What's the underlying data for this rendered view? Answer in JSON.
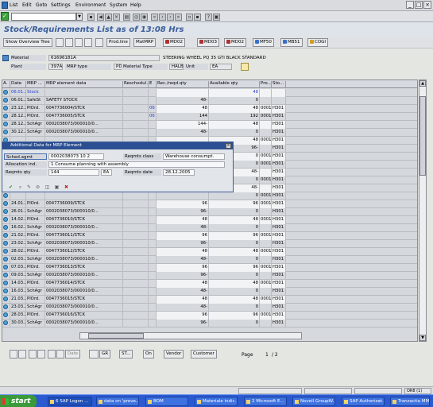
{
  "menu": [
    "List",
    "Edit",
    "Goto",
    "Settings",
    "Environment",
    "System",
    "Help"
  ],
  "title": "Stock/Requirements List as of 13:08 Hrs",
  "toolbar": {
    "show_overview_tree": "Show Overview Tree",
    "prod_line": "Prod.line",
    "mat_mrp": "MatMRP",
    "md02a": "MD02",
    "md03": "MD03",
    "md02b": "MD02",
    "mf50": "MF50",
    "mb51": "MB51",
    "cogi": "COGI"
  },
  "header": {
    "material_label": "Material",
    "material_value": "61696181A",
    "material_desc": "STEERING WHEEL PQ 35 GTI BLACK STANDARD",
    "plant_label": "Plant",
    "plant_value": "397A",
    "mrp_type_label": "MRP type",
    "mrp_type_value": "PD",
    "material_type_label": "Material Type",
    "material_type_value": "HALB",
    "unit_label": "Unit",
    "unit_value": "EA"
  },
  "grid": {
    "columns": [
      "A.",
      "Date",
      "MRP ...",
      "MRP element data",
      "Reschedul...",
      "E",
      "Rec./reqd.qty",
      "Available qty",
      "Pro...",
      "Sto..."
    ],
    "rows": [
      {
        "date": "06.01.2006",
        "mrp": "Stock",
        "data": "",
        "resch": "",
        "e": "",
        "rec": "",
        "avail": "48",
        "pro": "",
        "sto": "",
        "blue": true
      },
      {
        "date": "06.01.2006",
        "mrp": "SafeSt",
        "data": "SAFETY STOCK",
        "resch": "",
        "e": "",
        "rec": "48-",
        "avail": "0",
        "pro": "",
        "sto": ""
      },
      {
        "date": "23.12.2005",
        "mrp": "PlOrd.",
        "data": "0047736004/STCK",
        "resch": "",
        "e": "06",
        "rec": "48",
        "avail": "48",
        "pro": "0001",
        "sto": "H301"
      },
      {
        "date": "28.12.2005",
        "mrp": "PlOrd.",
        "data": "0047736005/STCK",
        "resch": "",
        "e": "06",
        "rec": "144",
        "avail": "192",
        "pro": "0001",
        "sto": "H301"
      },
      {
        "date": "28.12.2005",
        "mrp": "SchAgr",
        "data": "0002038073/000010/0...",
        "resch": "",
        "e": "",
        "rec": "144-",
        "avail": "48",
        "pro": "",
        "sto": "H301"
      },
      {
        "date": "30.12.2005",
        "mrp": "SchAgr",
        "data": "0002038073/000010/0...",
        "resch": "",
        "e": "",
        "rec": "48-",
        "avail": "0",
        "pro": "",
        "sto": "H301"
      },
      {
        "date": "",
        "mrp": "",
        "data": "",
        "resch": "",
        "e": "",
        "rec": "",
        "avail": "48",
        "pro": "0001",
        "sto": "H301"
      },
      {
        "date": "",
        "mrp": "",
        "data": "",
        "resch": "",
        "e": "",
        "rec": "",
        "avail": "96-",
        "pro": "",
        "sto": "H301"
      },
      {
        "date": "",
        "mrp": "",
        "data": "",
        "resch": "",
        "e": "",
        "rec": "",
        "avail": "0",
        "pro": "0001",
        "sto": "H301"
      },
      {
        "date": "",
        "mrp": "",
        "data": "",
        "resch": "",
        "e": "",
        "rec": "",
        "avail": "0",
        "pro": "0001",
        "sto": "H301"
      },
      {
        "date": "",
        "mrp": "",
        "data": "",
        "resch": "",
        "e": "",
        "rec": "",
        "avail": "48-",
        "pro": "",
        "sto": "H301"
      },
      {
        "date": "",
        "mrp": "",
        "data": "",
        "resch": "",
        "e": "",
        "rec": "",
        "avail": "0",
        "pro": "0001",
        "sto": "H301"
      },
      {
        "date": "",
        "mrp": "",
        "data": "",
        "resch": "",
        "e": "",
        "rec": "",
        "avail": "48-",
        "pro": "",
        "sto": "H301"
      },
      {
        "date": "",
        "mrp": "",
        "data": "",
        "resch": "",
        "e": "",
        "rec": "",
        "avail": "0",
        "pro": "0001",
        "sto": "H301"
      },
      {
        "date": "24.01.2006",
        "mrp": "PlOrd.",
        "data": "0047736009/STCK",
        "resch": "",
        "e": "",
        "rec": "96",
        "avail": "96",
        "pro": "0001",
        "sto": "H301"
      },
      {
        "date": "26.01.2006",
        "mrp": "SchAgr",
        "data": "0002038073/000010/0...",
        "resch": "",
        "e": "",
        "rec": "96-",
        "avail": "0",
        "pro": "",
        "sto": "H301"
      },
      {
        "date": "14.02.2006",
        "mrp": "PlOrd.",
        "data": "0047736010/STCK",
        "resch": "",
        "e": "",
        "rec": "48",
        "avail": "48",
        "pro": "0001",
        "sto": "H301"
      },
      {
        "date": "16.02.2006",
        "mrp": "SchAgr",
        "data": "0002038073/000010/0...",
        "resch": "",
        "e": "",
        "rec": "48-",
        "avail": "0",
        "pro": "",
        "sto": "H301"
      },
      {
        "date": "21.02.2006",
        "mrp": "PlOrd.",
        "data": "0047736011/STCK",
        "resch": "",
        "e": "",
        "rec": "96",
        "avail": "96",
        "pro": "0001",
        "sto": "H301"
      },
      {
        "date": "23.02.2006",
        "mrp": "SchAgr",
        "data": "0002038073/000010/0...",
        "resch": "",
        "e": "",
        "rec": "96-",
        "avail": "0",
        "pro": "",
        "sto": "H301"
      },
      {
        "date": "28.02.2006",
        "mrp": "PlOrd.",
        "data": "0047736012/STCK",
        "resch": "",
        "e": "",
        "rec": "48",
        "avail": "48",
        "pro": "0001",
        "sto": "H301"
      },
      {
        "date": "02.03.2006",
        "mrp": "SchAgr",
        "data": "0002038073/000010/0...",
        "resch": "",
        "e": "",
        "rec": "48-",
        "avail": "0",
        "pro": "",
        "sto": "H301"
      },
      {
        "date": "07.03.2006",
        "mrp": "PlOrd.",
        "data": "0047736013/STCK",
        "resch": "",
        "e": "",
        "rec": "96",
        "avail": "96",
        "pro": "0001",
        "sto": "H301"
      },
      {
        "date": "09.03.2006",
        "mrp": "SchAgr",
        "data": "0002038073/000010/0...",
        "resch": "",
        "e": "",
        "rec": "96-",
        "avail": "0",
        "pro": "",
        "sto": "H301"
      },
      {
        "date": "14.03.2006",
        "mrp": "PlOrd.",
        "data": "0047736014/STCK",
        "resch": "",
        "e": "",
        "rec": "48",
        "avail": "48",
        "pro": "0001",
        "sto": "H301"
      },
      {
        "date": "16.03.2006",
        "mrp": "SchAgr",
        "data": "0002038073/000010/0...",
        "resch": "",
        "e": "",
        "rec": "48-",
        "avail": "0",
        "pro": "",
        "sto": "H301"
      },
      {
        "date": "21.03.2006",
        "mrp": "PlOrd.",
        "data": "0047736015/STCK",
        "resch": "",
        "e": "",
        "rec": "48",
        "avail": "48",
        "pro": "0001",
        "sto": "H301"
      },
      {
        "date": "23.03.2006",
        "mrp": "SchAgr",
        "data": "0002038073/000010/0...",
        "resch": "",
        "e": "",
        "rec": "48-",
        "avail": "0",
        "pro": "",
        "sto": "H301"
      },
      {
        "date": "28.03.2006",
        "mrp": "PlOrd.",
        "data": "0047736016/STCK",
        "resch": "",
        "e": "",
        "rec": "96",
        "avail": "96",
        "pro": "0001",
        "sto": "H301"
      },
      {
        "date": "30.03.2006",
        "mrp": "SchAgr",
        "data": "0002038073/000010/0...",
        "resch": "",
        "e": "",
        "rec": "96-",
        "avail": "0",
        "pro": "",
        "sto": "H301"
      }
    ]
  },
  "popup": {
    "title": "Additional Data for MRP Element",
    "sched_agmt_label": "Sched.agmt",
    "sched_agmt_value": "0002038073  10     2",
    "reqmts_class_label": "Reqmts class",
    "reqmts_class_value": "Warehouse consumpt.",
    "allocation_ind_label": "Allocation ind.",
    "allocation_ind_value": "1  Consume planning with assembly",
    "reqmts_qty_label": "Reqmts qty",
    "reqmts_qty_value": "144",
    "reqmts_qty_unit": "EA",
    "reqmts_date_label": "Reqmts date",
    "reqmts_date_value": "28.12.2005"
  },
  "bottom": {
    "date_btn": "Date",
    "gr_btn": "GR",
    "st_btn": "ST...",
    "on_btn": "On",
    "vendor_btn": "Vendor",
    "customer_btn": "Customer",
    "page_label": "Page",
    "page_current": "1",
    "page_total": "/  2"
  },
  "status": {
    "right": "OR8 (1)"
  },
  "taskbar": {
    "start": "start",
    "tasks": [
      "6 SAP Logon ...",
      "data on 'preve...",
      "BOM",
      "Materiale indir...",
      "2 Microsoft E...",
      "Novell GroupW...",
      "SAP Authorizat...",
      "Tranzactia MM..."
    ],
    "clock": ""
  }
}
